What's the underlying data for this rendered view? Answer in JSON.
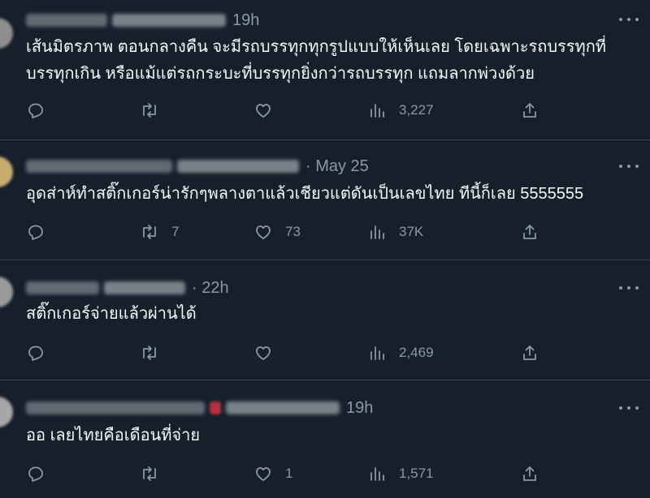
{
  "tweets": [
    {
      "time": "19h",
      "text_lines": [
        "เส้นมิตรภาพ ตอนกลางคืน จะมีรถบรรทุกทุกรูปแบบให้เห็นเลย โดยเฉพาะรถบรรทุกที่",
        "บรรทุกเกิน หรือแม้แต่รถกระบะที่บรรทุกยิ่งกว่ารถบรรทุก แถมลากพ่วงด้วย"
      ],
      "replies": "",
      "retweets": "",
      "likes": "",
      "views": "3,227"
    },
    {
      "time": "· May 25",
      "text_lines": [
        "อุดส่าห์ทำสติ๊กเกอร์น่ารักๆพลางตาแล้วเชียวแต่ดันเป็นเลขไทย ทีนี้ก็เลย 5555555"
      ],
      "replies": "",
      "retweets": "7",
      "likes": "73",
      "views": "37K"
    },
    {
      "time": "· 22h",
      "text_lines": [
        "สติ๊กเกอร์จ่ายแล้วผ่านได้"
      ],
      "replies": "",
      "retweets": "",
      "likes": "",
      "views": "2,469"
    },
    {
      "time": "19h",
      "text_lines": [
        "ออ เลยไทยคือเดือนที่จ่าย"
      ],
      "replies": "",
      "retweets": "",
      "likes": "1",
      "views": "1,571"
    }
  ],
  "icons": {
    "reply": "reply-icon",
    "retweet": "retweet-icon",
    "like": "heart-icon",
    "views": "views-icon",
    "share": "share-icon",
    "more": "more-icon"
  },
  "colors": {
    "background": "#15202b",
    "text": "#f7f9f9",
    "muted": "#8b98a5",
    "divider": "#38444d"
  }
}
